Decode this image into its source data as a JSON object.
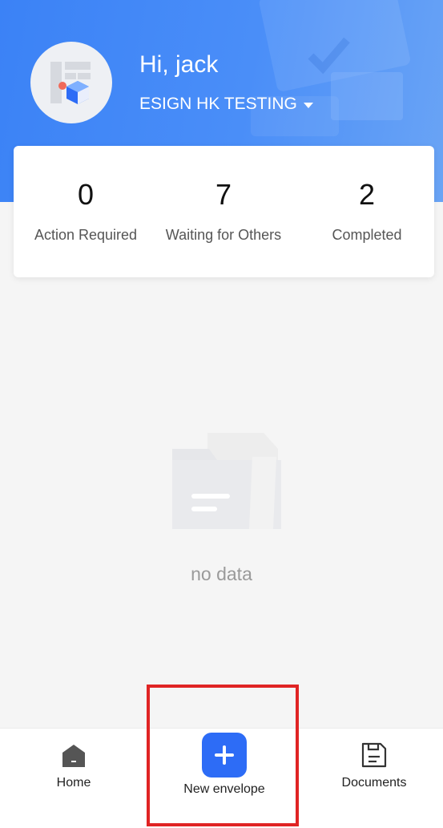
{
  "header": {
    "greeting": "Hi, jack",
    "organization": "ESIGN HK TESTING"
  },
  "stats": [
    {
      "count": "0",
      "label": "Action Required"
    },
    {
      "count": "7",
      "label": "Waiting for Others"
    },
    {
      "count": "2",
      "label": "Completed"
    }
  ],
  "empty_state": {
    "text": "no data"
  },
  "tabbar": {
    "home": "Home",
    "new_envelope": "New envelope",
    "documents": "Documents"
  },
  "colors": {
    "header_blue": "#3b82f6",
    "primary": "#2d6cf6",
    "highlight_red": "#e02424"
  },
  "icons": [
    "avatar-logo-icon",
    "caret-down-icon",
    "empty-folder-icon",
    "home-icon",
    "plus-icon",
    "documents-icon"
  ]
}
